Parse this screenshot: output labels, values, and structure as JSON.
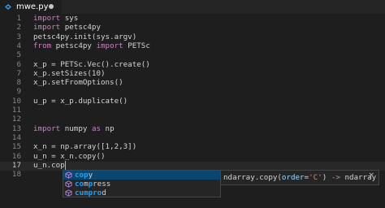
{
  "tab": {
    "filename": "mwe.py",
    "icon": "python-file-icon"
  },
  "editor": {
    "line_numbers": [
      "1",
      "2",
      "3",
      "4",
      "5",
      "6",
      "7",
      "8",
      "9",
      "10",
      "11",
      "12",
      "13",
      "14",
      "15",
      "16",
      "17",
      "18"
    ],
    "active_line": "17",
    "lines": {
      "l1": {
        "kw": "import",
        "rest": " sys"
      },
      "l2": {
        "kw": "import",
        "rest": " petsc4py"
      },
      "l3": {
        "text": "petsc4py.init(sys.argv)"
      },
      "l4": {
        "kw1": "from",
        "mid": " petsc4py ",
        "kw2": "import",
        "rest": " PETSc"
      },
      "l6": {
        "text": "x_p = PETSc.Vec().create()"
      },
      "l7": {
        "text": "x_p.setSizes(10)"
      },
      "l8": {
        "text": "x_p.setFromOptions()"
      },
      "l10": {
        "text": "u_p = x_p.duplicate()"
      },
      "l13": {
        "kw1": "import",
        "mid": " numpy ",
        "kw2": "as",
        "rest": " np"
      },
      "l15": {
        "text": "x_n = np.array([1,2,3])"
      },
      "l16": {
        "text": "u_n = x_n.copy()"
      },
      "l17": {
        "text": "u_n.cop"
      }
    }
  },
  "suggestions": {
    "items": [
      {
        "match": "cop",
        "rest": "y",
        "icon": "method-cube-icon"
      },
      {
        "m1": "co",
        "mid": "m",
        "m2": "p",
        "rest": "ress",
        "icon": "method-cube-icon"
      },
      {
        "m1": "cu",
        "mid": "",
        "m2": "mpro",
        "rest": "d",
        "icon": "method-cube-icon"
      }
    ],
    "selected_index": 0
  },
  "details": {
    "name": "ndarray.copy(",
    "param": "order",
    "eq": "=",
    "str": "'C'",
    "close_paren": ") ",
    "arrow": "->",
    "ret": " ndarray",
    "close_glyph": "×"
  },
  "colors": {
    "background": "#1e1e1e",
    "keyword": "#c586c0",
    "match_highlight": "#18a3ff",
    "selection": "#094771"
  }
}
